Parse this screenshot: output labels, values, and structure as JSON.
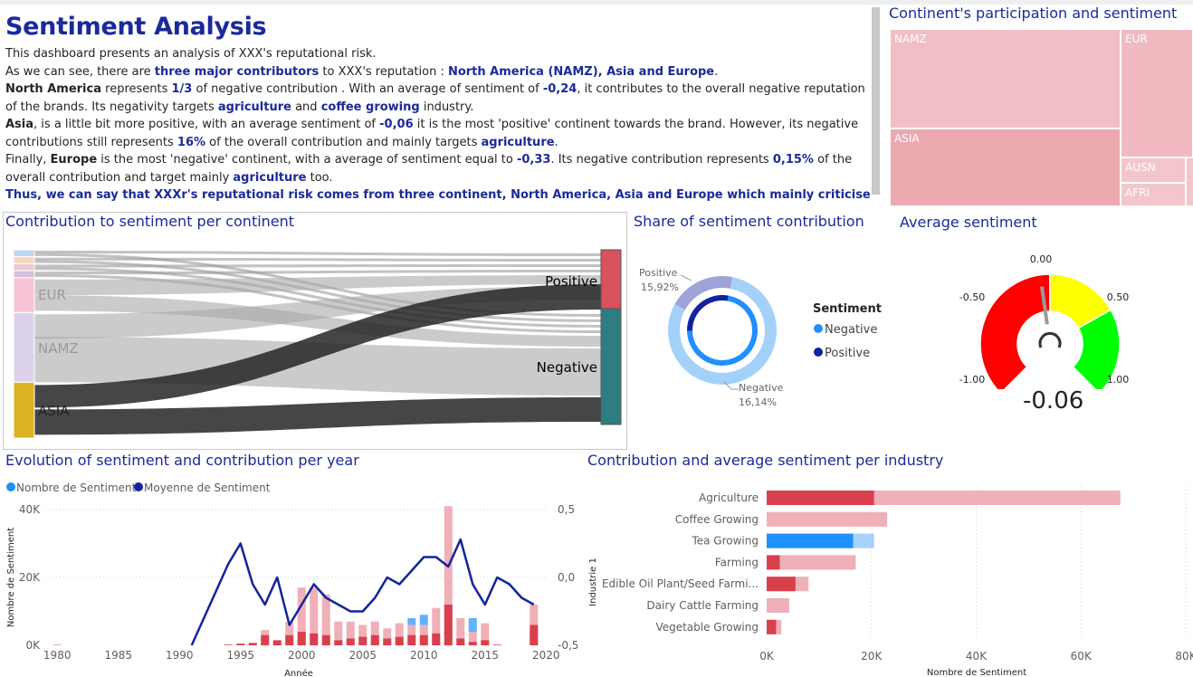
{
  "dashboard": {
    "title": "Sentiment Analysis",
    "narrative": {
      "p1": "This dashboard presents an analysis of XXX's reputational risk.",
      "p2_a": "As we can see, there are ",
      "p2_b": "three major contributors",
      "p2_c": " to XXX's reputation : ",
      "p2_d": "North America (NAMZ), Asia and Europe",
      "p2_e": ".",
      "p3_a": "North America",
      "p3_b": " represents ",
      "p3_c": "1/3",
      "p3_d": " of negative contribution . With an average of sentiment of ",
      "p3_e": "-0,24",
      "p3_f": ", it contributes to the overall negative reputation of the brands. Its negativity targets ",
      "p3_g": "agriculture",
      "p3_h": " and ",
      "p3_i": "coffee growing",
      "p3_j": " industry.",
      "p4_a": "Asia",
      "p4_b": ", is a little bit more positive, with an average sentiment of ",
      "p4_c": "-0,06",
      "p4_d": " it is the most 'positive' continent towards the brand. However, its negative contributions still represents ",
      "p4_e": "16%",
      "p4_f": " of the overall contribution and mainly targets ",
      "p4_g": "agriculture",
      "p4_h": ".",
      "p5_a": "Finally, ",
      "p5_b": "Europe",
      "p5_c": " is the most 'negative' continent, with a average of sentiment equal to ",
      "p5_d": "-0,33",
      "p5_e": ". Its negative contribution represents ",
      "p5_f": "0,15%",
      "p5_g": " of the overall contribution and target mainly ",
      "p5_h": "agriculture",
      "p5_i": " too.",
      "p6": "Thus, we can say that XXXr's reputational risk comes from three continent, North America, Asia and Europe which mainly criticise XXX's"
    }
  },
  "treemap": {
    "title": "Continent's participation and sentiment",
    "tiles": [
      {
        "label": "NAMZ",
        "color": "#f0bec4"
      },
      {
        "label": "EUR",
        "color": "#f0bac0"
      },
      {
        "label": "ASIA",
        "color": "#eba9b0"
      },
      {
        "label": "AUSN",
        "color": "#f2c6cb"
      },
      {
        "label": "AFRI",
        "color": "#f2c6cb"
      }
    ]
  },
  "sankey": {
    "title": "Contribution to sentiment per continent",
    "sources": [
      {
        "label": "",
        "value": 1,
        "color": "#bcd8f0"
      },
      {
        "label": "",
        "value": 1,
        "color": "#f8d7b9"
      },
      {
        "label": "",
        "value": 1,
        "color": "#ecc7d6"
      },
      {
        "label": "",
        "value": 1,
        "color": "#d4c2dd"
      },
      {
        "label": "EUR",
        "value": 5,
        "color": "#f7c4d6"
      },
      {
        "label": "NAMZ",
        "value": 10,
        "color": "#ddd2ec"
      },
      {
        "label": "ASIA",
        "value": 8,
        "color": "#dcb423"
      }
    ],
    "targets": [
      {
        "label": "Positive",
        "color": "#d9505e"
      },
      {
        "label": "Negative",
        "color": "#2e7d80"
      }
    ]
  },
  "donut": {
    "title": "Share of sentiment contribution",
    "legend_title": "Sentiment",
    "legend": [
      {
        "label": "Negative",
        "color": "#1e90ff"
      },
      {
        "label": "Positive",
        "color": "#12239e"
      }
    ],
    "labels": {
      "positive_name": "Positive",
      "positive_value": "15,92%",
      "negative_name": "Negative",
      "negative_value": "16,14%"
    },
    "outer": {
      "positive_share": 0.2,
      "negative_share": 0.8
    },
    "inner": {
      "positive_share": 0.28,
      "negative_share": 0.72
    }
  },
  "gauge": {
    "title": "Average sentiment",
    "value": -0.06,
    "value_label": "-0.06",
    "min": -1.0,
    "max": 1.0,
    "ticks": {
      "t_min": "-1.00",
      "t_m50": "-0.50",
      "t_0": "0.00",
      "t_p50": "0.50",
      "t_max": "1.00"
    },
    "bands": [
      {
        "from": -1.0,
        "to": -0.0,
        "color": "#ff0000"
      },
      {
        "from": 0.0,
        "to": 0.45,
        "color": "#ffff00"
      },
      {
        "from": 0.45,
        "to": 1.0,
        "color": "#00ff00"
      }
    ]
  },
  "evolution": {
    "title": "Evolution of sentiment and contribution per year",
    "legend": [
      {
        "label": "Nombre de Sentiment",
        "color": "#1e90ff"
      },
      {
        "label": "Moyenne de Sentiment",
        "color": "#12239e"
      }
    ],
    "y_left_label": "Nombre de Sentiment",
    "x_label": "Année",
    "y_left_ticks": [
      "40K",
      "20K",
      "0K"
    ],
    "y_right_ticks": [
      "0,5",
      "0,0",
      "-0,5"
    ],
    "x_ticks": [
      "1980",
      "1985",
      "1990",
      "1995",
      "2000",
      "2005",
      "2010",
      "2015",
      "2020"
    ]
  },
  "chart_data": [
    {
      "type": "bar",
      "title": "Evolution of sentiment and contribution per year",
      "xlabel": "Année",
      "ylabel": "Nombre de Sentiment",
      "ylim": [
        0,
        40000
      ],
      "y2lim": [
        -0.5,
        0.5
      ],
      "x": [
        1980,
        1981,
        1982,
        1983,
        1984,
        1985,
        1986,
        1987,
        1988,
        1989,
        1990,
        1991,
        1992,
        1993,
        1994,
        1995,
        1996,
        1997,
        1998,
        1999,
        2000,
        2001,
        2002,
        2003,
        2004,
        2005,
        2006,
        2007,
        2008,
        2009,
        2010,
        2011,
        2012,
        2013,
        2014,
        2015,
        2016,
        2017,
        2018,
        2019
      ],
      "series": [
        {
          "name": "Nombre de Sentiment (negative)",
          "color": "#d9404e",
          "values": [
            0,
            0,
            0,
            0,
            0,
            0,
            0,
            0,
            0,
            0,
            0,
            0,
            0,
            0,
            200,
            500,
            700,
            3000,
            1500,
            3000,
            4000,
            3500,
            3000,
            1500,
            2000,
            2500,
            3000,
            2000,
            2500,
            3000,
            3000,
            3500,
            12000,
            2000,
            1000,
            1500,
            200,
            0,
            0,
            6000
          ]
        },
        {
          "name": "Nombre de Sentiment (positive-share)",
          "color": "#efb0b8",
          "values": [
            300,
            0,
            0,
            0,
            0,
            0,
            0,
            0,
            0,
            0,
            0,
            0,
            0,
            0,
            0,
            0,
            500,
            4500,
            1500,
            7000,
            17000,
            17000,
            15000,
            7000,
            7000,
            6000,
            7000,
            5000,
            6500,
            6000,
            6000,
            11000,
            41000,
            8000,
            4000,
            6500,
            0,
            0,
            0,
            12000
          ]
        },
        {
          "name": "Nombre de Sentiment (blue)",
          "color": "#1e90ff",
          "values": [
            0,
            0,
            0,
            0,
            0,
            0,
            0,
            0,
            0,
            0,
            0,
            0,
            0,
            0,
            0,
            0,
            0,
            0,
            0,
            0,
            0,
            0,
            0,
            0,
            0,
            0,
            0,
            0,
            0,
            2000,
            3000,
            0,
            0,
            0,
            4000,
            0,
            0,
            0,
            0,
            0
          ]
        },
        {
          "name": "Moyenne de Sentiment",
          "color": "#12239e",
          "values": [
            null,
            null,
            null,
            null,
            null,
            null,
            null,
            null,
            null,
            null,
            null,
            -0.5,
            -0.3,
            -0.1,
            0.1,
            0.25,
            -0.05,
            -0.2,
            0.0,
            -0.35,
            -0.2,
            -0.05,
            -0.15,
            -0.2,
            -0.25,
            -0.25,
            -0.15,
            0.0,
            -0.05,
            0.05,
            0.15,
            0.15,
            0.08,
            0.28,
            -0.05,
            -0.2,
            0.0,
            -0.05,
            -0.15,
            -0.2
          ]
        }
      ]
    },
    {
      "type": "bar",
      "title": "Contribution and average sentiment per industry",
      "xlabel": "Nombre de Sentiment",
      "ylabel": "Industrie 1",
      "xlim": [
        0,
        80000
      ],
      "x_ticks": [
        "0K",
        "20K",
        "40K",
        "60K",
        "80K"
      ],
      "categories": [
        "Agriculture",
        "Coffee Growing",
        "Tea Growing",
        "Farming",
        "Edible Oil Plant/Seed Farmi...",
        "Dairy Cattle Farming",
        "Vegetable Growing"
      ],
      "series": [
        {
          "name": "highlight",
          "values": [
            20500,
            0,
            16500,
            2500,
            5500,
            0,
            1800
          ],
          "colors": [
            "#d9404e",
            "#d9404e",
            "#1e90ff",
            "#d9404e",
            "#d9404e",
            "#d9404e",
            "#d9404e"
          ]
        },
        {
          "name": "total",
          "values": [
            67500,
            23000,
            20500,
            17000,
            8000,
            4300,
            2800
          ],
          "colors": [
            "#efb0b8",
            "#efb0b8",
            "#a7d2fb",
            "#efb0b8",
            "#efb0b8",
            "#efb0b8",
            "#efb0b8"
          ]
        }
      ]
    }
  ],
  "industry": {
    "title": "Contribution and average sentiment per industry",
    "y_label": "Industrie 1",
    "x_label": "Nombre de Sentiment"
  }
}
